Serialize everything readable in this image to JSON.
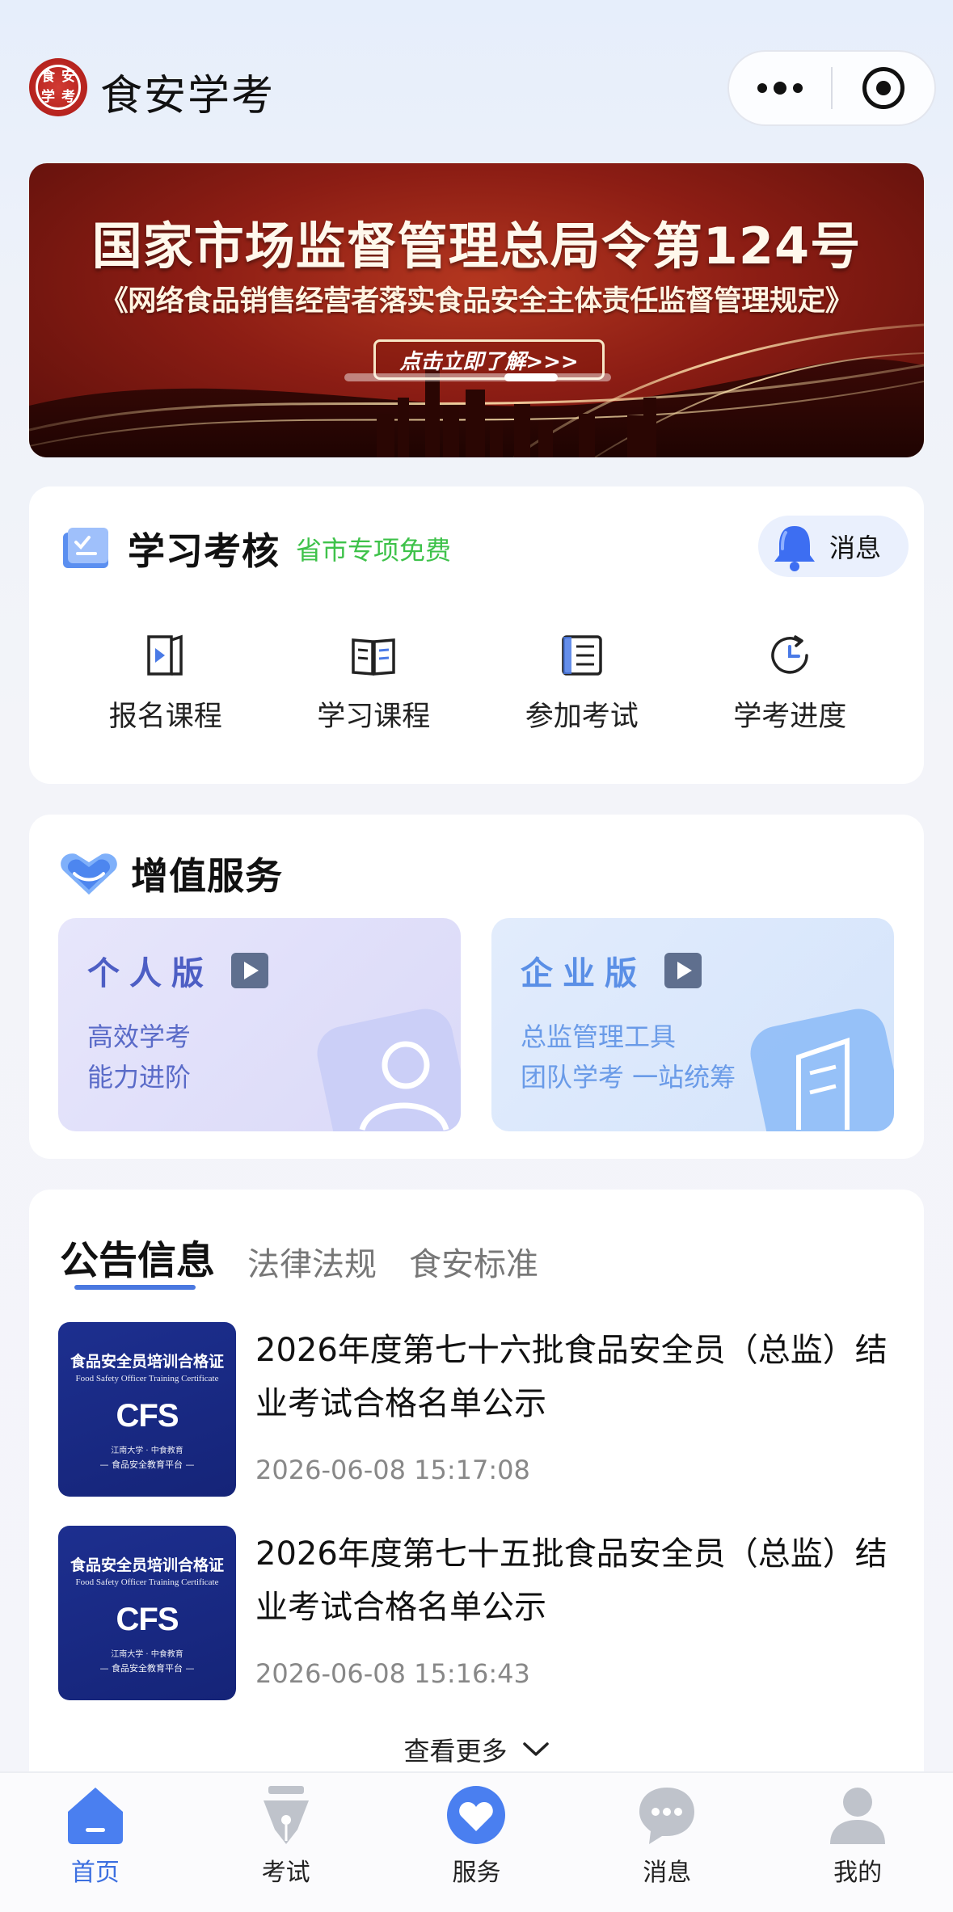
{
  "header": {
    "app_title": "食安学考",
    "logo_chars": [
      "食",
      "安",
      "学",
      "考"
    ]
  },
  "banner": {
    "title": "国家市场监督管理总局令第124号",
    "subtitle": "《网络食品销售经营者落实食品安全主体责任监督管理规定》",
    "cta": "点击立即了解>>>"
  },
  "study": {
    "title": "学习考核",
    "badge": "省市专项免费",
    "message_label": "消息",
    "items": [
      {
        "label": "报名课程",
        "icon": "video-book-icon"
      },
      {
        "label": "学习课程",
        "icon": "open-book-icon"
      },
      {
        "label": "参加考试",
        "icon": "exam-paper-icon"
      },
      {
        "label": "学考进度",
        "icon": "progress-clock-icon"
      }
    ]
  },
  "value_added": {
    "title": "增值服务",
    "personal": {
      "title": "个人版",
      "line1": "高效学考",
      "line2": "能力进阶"
    },
    "enterprise": {
      "title": "企业版",
      "line1": "总监管理工具",
      "line2": "团队学考 一站统筹"
    }
  },
  "news": {
    "tabs": [
      "公告信息",
      "法律法规",
      "食安标准"
    ],
    "active_tab": 0,
    "cert": {
      "title_cn": "食品安全员培训合格证",
      "title_en": "Food Safety Officer Training Certificate",
      "logo": "CFS",
      "org": "江南大学 · 中食教育",
      "footer": "— 食品安全教育平台 —"
    },
    "items": [
      {
        "title": "2026年度第七十六批食品安全员（总监）结业考试合格名单公示",
        "date": "2026-06-08 15:17:08"
      },
      {
        "title": "2026年度第七十五批食品安全员（总监）结业考试合格名单公示",
        "date": "2026-06-08 15:16:43"
      }
    ],
    "more_label": "查看更多"
  },
  "tabbar": {
    "items": [
      {
        "label": "首页",
        "icon": "home-icon",
        "active": true
      },
      {
        "label": "考试",
        "icon": "pen-icon",
        "active": false
      },
      {
        "label": "服务",
        "icon": "heart-service-icon",
        "active": false
      },
      {
        "label": "消息",
        "icon": "chat-bubble-icon",
        "active": false
      },
      {
        "label": "我的",
        "icon": "user-icon",
        "active": false
      }
    ]
  },
  "colors": {
    "accent_blue": "#3c6fe0",
    "badge_green": "#3ec24a",
    "banner_red": "#8c1d14",
    "cert_navy": "#1d2f8f"
  }
}
